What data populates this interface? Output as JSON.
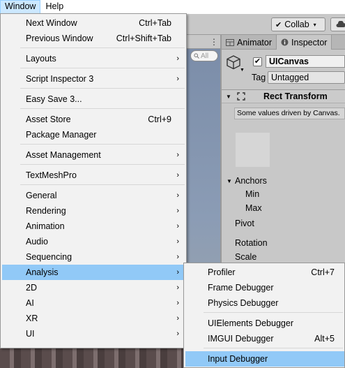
{
  "menubar": [
    {
      "label": "Window",
      "active": true
    },
    {
      "label": "Help",
      "active": false
    }
  ],
  "toolbar": {
    "collab_label": "Collab",
    "collab_caret": "▾",
    "check_glyph": "✔"
  },
  "scene": {
    "search_placeholder": "All",
    "menu_glyph": "⋮"
  },
  "inspector": {
    "tabs": [
      "Animator",
      "Inspector"
    ],
    "object_name": "UICanvas",
    "checkbox": "✔",
    "tag_label": "Tag",
    "tag_value": "Untagged",
    "component_title": "Rect Transform",
    "driven_note": "Some values driven by Canvas.",
    "anchors_label": "Anchors",
    "min_label": "Min",
    "max_label": "Max",
    "pivot_label": "Pivot",
    "rotation_label": "Rotation",
    "scale_label": "Scale",
    "fold_open": "▼"
  },
  "window_menu": {
    "arrow": "›",
    "items": [
      {
        "label": "Next Window",
        "shortcut": "Ctrl+Tab"
      },
      {
        "label": "Previous Window",
        "shortcut": "Ctrl+Shift+Tab"
      },
      {
        "label": "Layouts",
        "submenu": true
      },
      {
        "label": "Script Inspector 3",
        "submenu": true
      },
      {
        "label": "Easy Save 3..."
      },
      {
        "label": "Asset Store",
        "shortcut": "Ctrl+9"
      },
      {
        "label": "Package Manager"
      },
      {
        "label": "Asset Management",
        "submenu": true
      },
      {
        "label": "TextMeshPro",
        "submenu": true
      },
      {
        "label": "General",
        "submenu": true
      },
      {
        "label": "Rendering",
        "submenu": true
      },
      {
        "label": "Animation",
        "submenu": true
      },
      {
        "label": "Audio",
        "submenu": true
      },
      {
        "label": "Sequencing",
        "submenu": true
      },
      {
        "label": "Analysis",
        "submenu": true,
        "highlighted": true
      },
      {
        "label": "2D",
        "submenu": true
      },
      {
        "label": "AI",
        "submenu": true
      },
      {
        "label": "XR",
        "submenu": true
      },
      {
        "label": "UI",
        "submenu": true
      }
    ]
  },
  "analysis_submenu": {
    "items": [
      {
        "label": "Profiler",
        "shortcut": "Ctrl+7"
      },
      {
        "label": "Frame Debugger"
      },
      {
        "label": "Physics Debugger"
      },
      {
        "label": "UIElements Debugger"
      },
      {
        "label": "IMGUI Debugger",
        "shortcut": "Alt+5"
      },
      {
        "label": "Input Debugger",
        "highlighted": true
      }
    ]
  },
  "colors": {
    "highlight": "#91c9f7",
    "menu_bg": "#f2f2f2",
    "menubar_active": "#cce8ff",
    "panel_bg": "#c8c8c8"
  }
}
